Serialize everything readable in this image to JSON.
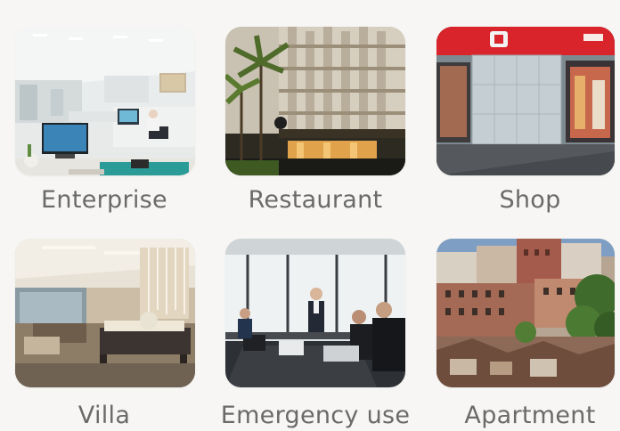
{
  "scenarios": [
    {
      "id": "enterprise",
      "label": "Enterprise"
    },
    {
      "id": "restaurant",
      "label": "Restaurant"
    },
    {
      "id": "shop",
      "label": "Shop"
    },
    {
      "id": "villa",
      "label": "Villa"
    },
    {
      "id": "emergency",
      "label": "Emergency use"
    },
    {
      "id": "apartment",
      "label": "Apartment"
    }
  ],
  "colors": {
    "background": "#f7f6f4",
    "label_text": "#6a6a6a",
    "shop_sign_red": "#d8242a"
  }
}
